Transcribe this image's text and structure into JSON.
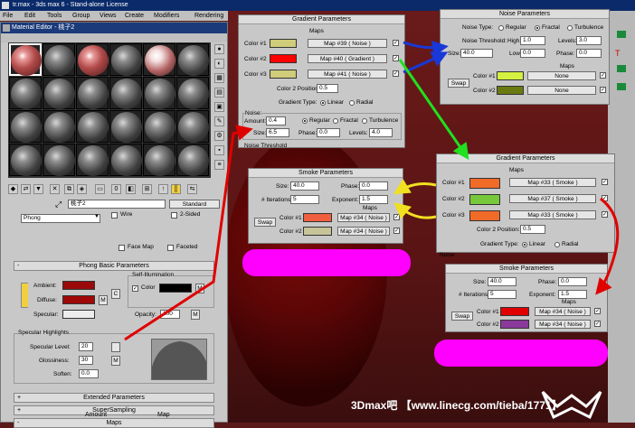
{
  "app": {
    "title": "tr.max - 3ds max 6 - Stand-alone License",
    "menu": [
      "File",
      "Edit",
      "Tools",
      "Group",
      "Views",
      "Create",
      "Modifiers",
      "Rendering"
    ]
  },
  "material_editor": {
    "title": "Material Editor - 桃子2",
    "material_name": "桃子2",
    "type_button": "Standard",
    "shader": "Phong",
    "wire_label": "Wire",
    "two_sided_label": "2-Sided",
    "face_map_label": "Face Map",
    "faceted_label": "Faceted",
    "phong_rollout": "Phong Basic Parameters",
    "self_illum_label": "Self-Illumination",
    "self_illum_color": "Color",
    "ambient_label": "Ambient:",
    "diffuse_label": "Diffuse:",
    "specular_label": "Specular:",
    "opacity_label": "Opacity:",
    "opacity_value": "100",
    "spec_highlights": "Specular Highlights",
    "specular_level_label": "Specular Level:",
    "specular_level_value": "20",
    "glossiness_label": "Glossiness:",
    "glossiness_value": "30",
    "soften_label": "Soften:",
    "soften_value": "0.0",
    "m": "M",
    "c": "C",
    "extended": "Extended Parameters",
    "supersampling": "SuperSampling",
    "maps": "Maps",
    "amount": "Amount",
    "map": "Map",
    "plus": "+",
    "minus": "-",
    "colors": {
      "ambient": "#9a0a0a",
      "diffuse": "#a00808",
      "specular": "#ededed",
      "self_illum": "#000000"
    }
  },
  "gradient1": {
    "title": "Gradient Parameters",
    "maps_label": "Maps",
    "color1_label": "Color #1",
    "color2_label": "Color #2",
    "color3_label": "Color #3",
    "map1": "Map #39  ( Noise )",
    "map2": "Map #40  ( Gradient )",
    "map3": "Map #41  ( Noise )",
    "color2_pos_label": "Color 2 Position:",
    "color2_pos_value": "0.5",
    "gradient_type_label": "Gradient Type:",
    "linear": "Linear",
    "radial": "Radial",
    "noise_label": "Noise:",
    "amount_label": "Amount:",
    "amount_value": "0.4",
    "regular": "Regular",
    "fractal": "Fractal",
    "turbulence": "Turbulence",
    "size_label": "Size:",
    "size_value": "6.5",
    "phase_label": "Phase:",
    "phase_value": "0.0",
    "levels_label": "Levels:",
    "levels_value": "4.0",
    "noise_threshold": "Noise Threshold",
    "colors": [
      "#cfcc7a",
      "#ff0000",
      "#cfcc7a"
    ]
  },
  "noise1": {
    "title": "Noise Parameters",
    "noise_type_label": "Noise Type:",
    "regular": "Regular",
    "fractal": "Fractal",
    "turbulence": "Turbulence",
    "threshold_label": "Noise Threshold:",
    "high_label": "High:",
    "high_value": "1.0",
    "levels_label": "Levels:",
    "levels_value": "3.0",
    "size_label": "Size:",
    "size_value": "40.0",
    "low_label": "Low:",
    "low_value": "0.0",
    "phase_label": "Phase:",
    "phase_value": "0.0",
    "maps_label": "Maps",
    "swap": "Swap",
    "color1_label": "Color #1",
    "color2_label": "Color #2",
    "none": "None",
    "colors": [
      "#d4f040",
      "#6a7a10"
    ]
  },
  "smoke1": {
    "title": "Smoke Parameters",
    "size_label": "Size:",
    "size_value": "40.0",
    "phase_label": "Phase:",
    "phase_value": "0.0",
    "iterations_label": "# Iterations:",
    "iterations_value": "5",
    "exponent_label": "Exponent:",
    "exponent_value": "1.5",
    "maps_label": "Maps",
    "swap": "Swap",
    "color1_label": "Color #1",
    "color2_label": "Color #2",
    "map1": "Map #34  ( Noise )",
    "map2": "Map #34  ( Noise )",
    "colors": [
      "#f06040",
      "#c8c49a"
    ]
  },
  "gradient2": {
    "title": "Gradient Parameters",
    "maps_label": "Maps",
    "color1_label": "Color #1",
    "color2_label": "Color #2",
    "color3_label": "Color #3",
    "map1": "Map #33  ( Smoke )",
    "map2": "Map #37  ( Smoke )",
    "map3": "Map #33  ( Smoke )",
    "color2_pos_label": "Color 2 Position:",
    "color2_pos_value": "0.5",
    "gradient_type_label": "Gradient Type:",
    "linear": "Linear",
    "radial": "Radial",
    "noise_label": "Noise",
    "colors": [
      "#f06a28",
      "#78c83c",
      "#f06a28"
    ]
  },
  "smoke2": {
    "title": "Smoke Parameters",
    "size_label": "Size:",
    "size_value": "40.0",
    "phase_label": "Phase:",
    "phase_value": "0.0",
    "iterations_label": "# Iterations:",
    "iterations_value": "5",
    "exponent_label": "Exponent:",
    "exponent_value": "1.5",
    "maps_label": "Maps",
    "swap": "Swap",
    "color1_label": "Color #1",
    "color2_label": "Color #2",
    "map1": "Map #34  ( Noise )",
    "map2": "Map #34  ( Noise )",
    "colors": [
      "#e00000",
      "#8a3a9a"
    ]
  },
  "watermark": "3Dmax吧 【www.linecg.com/tieba/1771】",
  "accents": {
    "magenta": "#ff00ff",
    "red_arrow": "#e00000",
    "blue_arrow": "#1838d8",
    "green_arrow": "#20e020",
    "yellow_arrow": "#f0e020"
  }
}
